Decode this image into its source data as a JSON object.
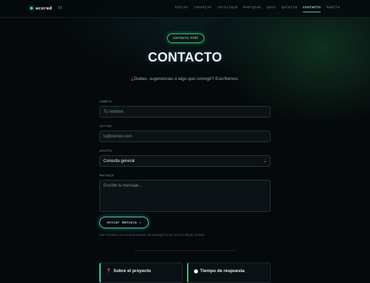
{
  "nav": {
    "brand": "ecored",
    "lang": "ES",
    "links": [
      "inicio",
      "consejos",
      "reciclaje",
      "energías",
      "quiz",
      "galería",
      "contacto",
      "huella"
    ],
    "active": "contacto"
  },
  "hero": {
    "pill": "contacto.html",
    "title": "CONTACTO",
    "subtitle": "¿Dudas, sugerencias o algo que corregir? Escríbenos."
  },
  "form": {
    "name_label": "nombre",
    "name_placeholder": "Tu nombre",
    "email_label": "correo",
    "email_placeholder": "tu@correo.com",
    "subject_label": "asunto",
    "subject_value": "Consulta general",
    "message_label": "mensaje",
    "message_placeholder": "Escribe tu mensaje...",
    "submit_label": "enviar mensaje",
    "submit_arrow": "→",
    "note": "Este formulario es una demostración: los mensajes no se envían a ningún servidor."
  },
  "cards": {
    "about_title": "Sobre el proyecto",
    "about_icon": "pin-icon",
    "response_title": "Tiempo de respuesta",
    "response_icon": "clock-icon"
  },
  "colors": {
    "accent": "#3fd0c0",
    "accent_green": "#2ecc71",
    "background": "#05090b"
  }
}
